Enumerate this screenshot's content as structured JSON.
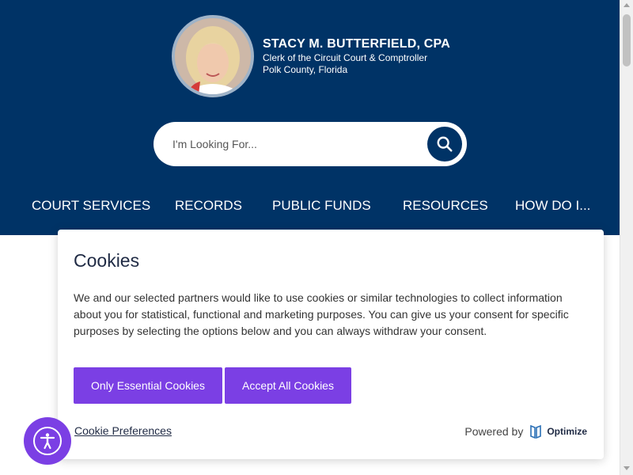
{
  "profile": {
    "name": "STACY M. BUTTERFIELD, CPA",
    "title": "Clerk of the Circuit Court & Comptroller",
    "location": "Polk County, Florida"
  },
  "search": {
    "placeholder": "I'm Looking For...",
    "icon": "search-icon"
  },
  "nav": {
    "items": [
      {
        "label": "COURT SERVICES"
      },
      {
        "label": "RECORDS"
      },
      {
        "label": "PUBLIC FUNDS"
      },
      {
        "label": "RESOURCES"
      },
      {
        "label": "HOW DO I..."
      }
    ]
  },
  "cookie_banner": {
    "title": "Cookies",
    "body": "We and our selected partners would like to use cookies or similar technologies to collect information about you for statistical, functional and marketing purposes. You can give us your consent for specific purposes by selecting the options below and you can always withdraw your consent.",
    "essential_label": "Only Essential Cookies",
    "accept_label": "Accept All Cookies",
    "preferences_label": "Cookie Preferences",
    "powered_by_label": "Powered by",
    "brand_name": "Optimize"
  },
  "accessibility": {
    "icon": "accessibility-icon"
  },
  "colors": {
    "header_bg": "#003366",
    "accent": "#7b3fe4",
    "text_dark": "#1f2a44"
  }
}
